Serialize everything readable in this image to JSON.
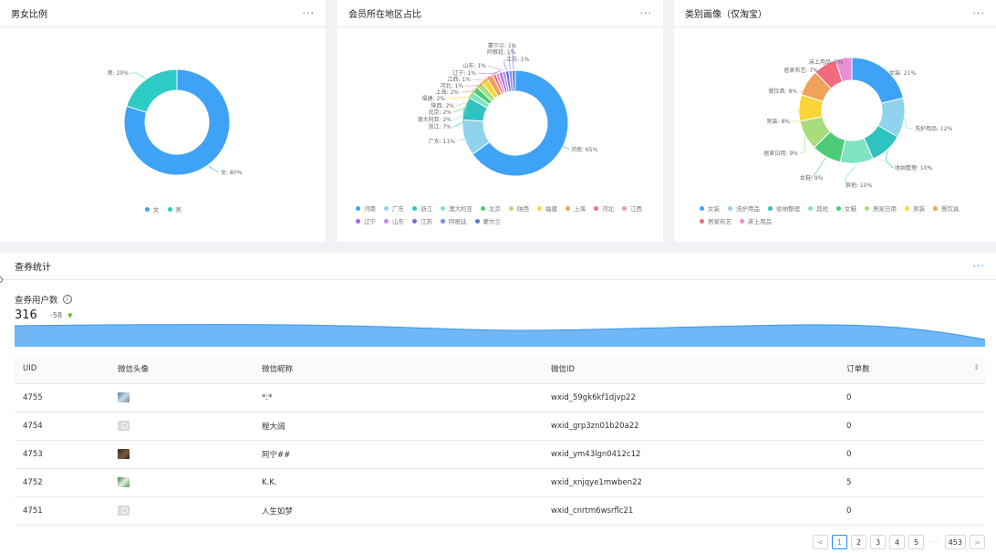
{
  "gender": {
    "title": "男女比例",
    "more": "···",
    "slices": [
      {
        "name": "女",
        "value": 80,
        "label": "女: 80%",
        "color": "#3ea2f6"
      },
      {
        "name": "男",
        "value": 20,
        "label": "男: 20%",
        "color": "#2ecbc4"
      }
    ]
  },
  "region": {
    "title": "会员所在地区占比",
    "more": "···",
    "slices": [
      {
        "name": "河南",
        "value": 65,
        "label": "河南: 65%",
        "color": "#3ea2f6"
      },
      {
        "name": "广东",
        "value": 11,
        "label": "广东: 11%",
        "color": "#8fd3ec"
      },
      {
        "name": "浙江",
        "value": 7,
        "label": "浙江: 7%",
        "color": "#2ec3c0"
      },
      {
        "name": "澳大利亚",
        "value": 2,
        "label": "澳大利亚: 2%",
        "color": "#7fe3c2"
      },
      {
        "name": "北京",
        "value": 2,
        "label": "北京: 2%",
        "color": "#4dcc76"
      },
      {
        "name": "陕西",
        "value": 2,
        "label": "陕西: 2%",
        "color": "#a8dd7b"
      },
      {
        "name": "福建",
        "value": 2,
        "label": "福建: 2%",
        "color": "#fbd537"
      },
      {
        "name": "上海",
        "value": 2,
        "label": "上海: 2%",
        "color": "#f0a15a"
      },
      {
        "name": "河北",
        "value": 1,
        "label": "河北: 1%",
        "color": "#f26a7d"
      },
      {
        "name": "江西",
        "value": 1,
        "label": "江西: 1%",
        "color": "#e98fd6"
      },
      {
        "name": "辽宁",
        "value": 1,
        "label": "辽宁: 1%",
        "color": "#a168e8"
      },
      {
        "name": "山东",
        "value": 1,
        "label": "山东: 1%",
        "color": "#c58ae8"
      },
      {
        "name": "江苏",
        "value": 1,
        "label": "江苏: 1%",
        "color": "#6a6fd6"
      },
      {
        "name": "阿根廷",
        "value": 1,
        "label": "阿根廷: 1%",
        "color": "#7a8ee0"
      },
      {
        "name": "蒙尔兰",
        "value": 1,
        "label": "蒙尔兰: 1%",
        "color": "#5a7ad6"
      }
    ]
  },
  "category": {
    "title": "类别画像（仅淘宝）",
    "more": "···",
    "slices": [
      {
        "name": "女装",
        "value": 21,
        "label": "女装: 21%",
        "color": "#3ea2f6"
      },
      {
        "name": "洗护用品",
        "value": 12,
        "label": "洗护用品: 12%",
        "color": "#8fd3ec"
      },
      {
        "name": "收纳整理",
        "value": 10,
        "label": "收纳整理: 10%",
        "color": "#2ec3c0"
      },
      {
        "name": "其他",
        "value": 10,
        "label": "其他: 10%",
        "color": "#7fe3c2"
      },
      {
        "name": "女鞋",
        "value": 9,
        "label": "女鞋: 9%",
        "color": "#4dcc76"
      },
      {
        "name": "居家日用",
        "value": 9,
        "label": "居家日用: 9%",
        "color": "#a8dd7b"
      },
      {
        "name": "男装",
        "value": 8,
        "label": "男装: 8%",
        "color": "#fbd537"
      },
      {
        "name": "餐饮具",
        "value": 8,
        "label": "餐饮具: 8%",
        "color": "#f0a15a"
      },
      {
        "name": "居家布艺",
        "value": 7,
        "label": "居家布艺: 7%",
        "color": "#f26a7d"
      },
      {
        "name": "床上用品",
        "value": 5,
        "label": "床上用品: 5%",
        "color": "#e98fd6"
      }
    ]
  },
  "stats": {
    "title": "查券统计",
    "more": "···",
    "metric_label": "查券用户数",
    "info_icon": "ⓘ",
    "metric_value": "316",
    "metric_delta": "-58",
    "delta_icon": "▼",
    "table": {
      "columns": [
        "UID",
        "微信头像",
        "微信昵称",
        "微信ID",
        "订单数"
      ],
      "sort_icon": "⬍",
      "rows": [
        {
          "uid": "4755",
          "avatar": "photo1",
          "nickname": "*:*",
          "wxid": "wxid_59gk6kf1djvp22",
          "orders": "0"
        },
        {
          "uid": "4754",
          "avatar": "default",
          "nickname": "程大阔",
          "wxid": "wxid_grp3zn01b20a22",
          "orders": "0"
        },
        {
          "uid": "4753",
          "avatar": "photo2",
          "nickname": "阿宁##",
          "wxid": "wxid_ym43lgn0412c12",
          "orders": "0"
        },
        {
          "uid": "4752",
          "avatar": "photo3",
          "nickname": "K.K.",
          "wxid": "wxid_xnjqye1mwben22",
          "orders": "5"
        },
        {
          "uid": "4751",
          "avatar": "default",
          "nickname": "人生如梦",
          "wxid": "wxid_cnrtm6wsrflc21",
          "orders": "0"
        }
      ]
    },
    "pagination": {
      "prev": "<",
      "pages": [
        "1",
        "2",
        "3",
        "4",
        "5"
      ],
      "ellipsis": "···",
      "last": "453",
      "next": ">",
      "current": "1"
    }
  }
}
